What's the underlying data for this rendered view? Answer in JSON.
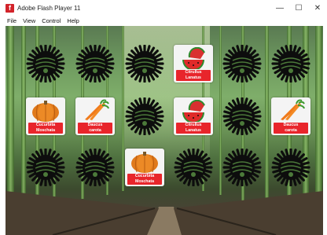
{
  "window": {
    "title": "Adobe Flash Player 11",
    "app_icon_glyph": "f",
    "minimize_glyph": "—",
    "maximize_glyph": "☐",
    "close_glyph": "✕"
  },
  "menu": [
    "File",
    "View",
    "Control",
    "Help"
  ],
  "cards": [
    {
      "state": "down"
    },
    {
      "state": "down"
    },
    {
      "state": "down"
    },
    {
      "state": "up",
      "icon": "watermelon-icon",
      "label_line1": "Citrullus",
      "label_line2": "Lanatus"
    },
    {
      "state": "down"
    },
    {
      "state": "down"
    },
    {
      "state": "up",
      "icon": "pumpkin-icon",
      "label_line1": "Cucurbita",
      "label_line2": "Moschata"
    },
    {
      "state": "up",
      "icon": "carrot-icon",
      "label_line1": "Daucus",
      "label_line2": "carota"
    },
    {
      "state": "down"
    },
    {
      "state": "up",
      "icon": "watermelon-icon",
      "label_line1": "Citrullus",
      "label_line2": "Lanatus"
    },
    {
      "state": "down"
    },
    {
      "state": "up",
      "icon": "carrot-icon",
      "label_line1": "Daucus",
      "label_line2": "carota"
    },
    {
      "state": "down"
    },
    {
      "state": "down"
    },
    {
      "state": "up",
      "icon": "pumpkin-icon",
      "label_line1": "Cucurbita",
      "label_line2": "Moschata"
    },
    {
      "state": "down"
    },
    {
      "state": "down"
    },
    {
      "state": "down"
    }
  ],
  "colors": {
    "label_red": "#e8252b",
    "card_back": "#0d0d0d"
  }
}
